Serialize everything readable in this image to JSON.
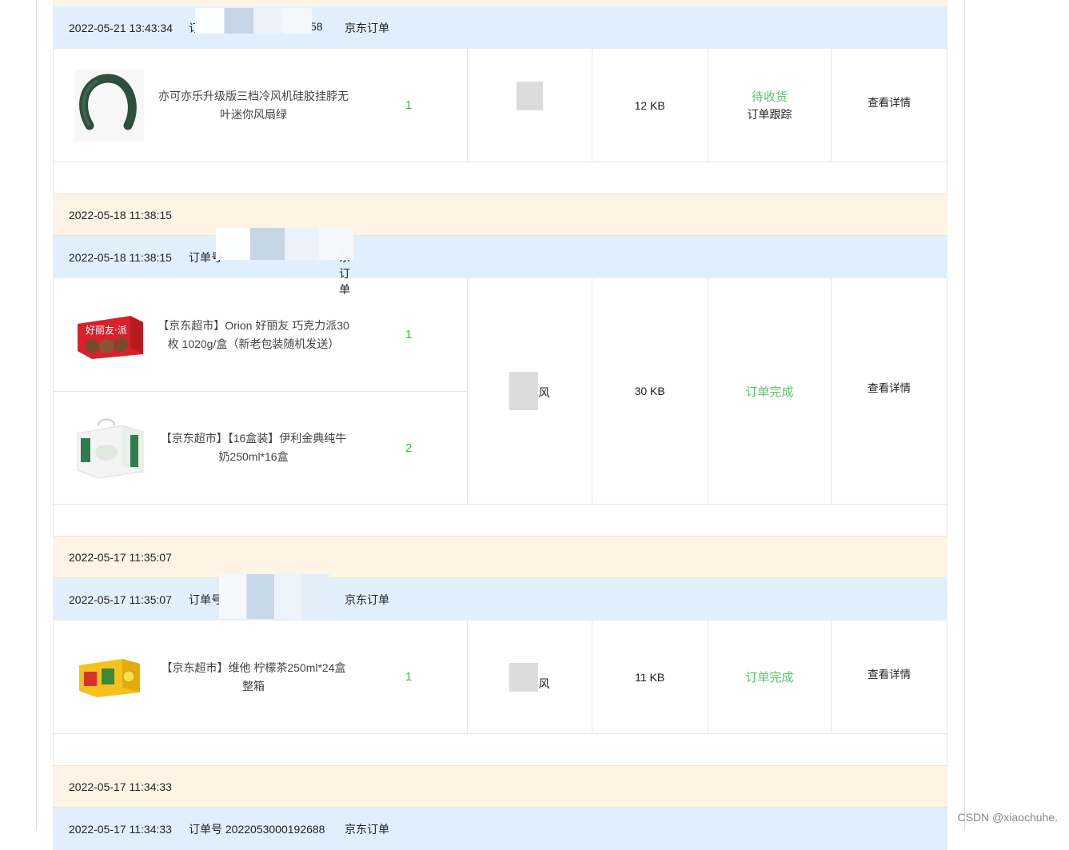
{
  "orders": [
    {
      "date_header": "",
      "time": "2022-05-21 13:43:34",
      "order_label": "订",
      "order_suffix": "58",
      "source": "京东订单",
      "items": [
        {
          "name": "亦可亦乐升级版三档冷风机硅胶挂脖无叶迷你风扇绿",
          "qty": "1",
          "img": "fan"
        }
      ],
      "pay_text": "",
      "size": "12  KB",
      "status": "待收货",
      "track": "订单跟踪",
      "action": "查看详情"
    },
    {
      "date_header": "2022-05-18 11:38:15",
      "time": "2022-05-18 11:38:15",
      "order_label": "订单号",
      "order_suffix": "东订单",
      "source": "",
      "items": [
        {
          "name": "【京东超市】Orion 好丽友 巧克力派30枚 1020g/盒（新老包装随机发送）",
          "qty": "1",
          "img": "orion"
        },
        {
          "name": "【京东超市】【16盒装】伊利金典纯牛奶250ml*16盒",
          "qty": "2",
          "img": "milk"
        }
      ],
      "pay_text": "风",
      "size": "30  KB",
      "status": "订单完成",
      "track": "",
      "action": "查看详情"
    },
    {
      "date_header": "2022-05-17 11:35:07",
      "time": "2022-05-17 11:35:07",
      "order_label": "订单号",
      "order_suffix": "",
      "source": "京东订单",
      "items": [
        {
          "name": "【京东超市】维他 柠檬茶250ml*24盒 整箱",
          "qty": "1",
          "img": "tea"
        }
      ],
      "pay_text": "风",
      "size": "11  KB",
      "status": "订单完成",
      "track": "",
      "action": "查看详情"
    },
    {
      "date_header": "2022-05-17 11:34:33",
      "time": "2022-05-17 11:34:33",
      "order_label": "订单号 2022053000192688",
      "order_suffix": "",
      "source": "京东订单",
      "items": [],
      "pay_text": "",
      "size": "",
      "status": "",
      "track": "",
      "action": ""
    }
  ],
  "watermark": "CSDN @xiaochuhe.",
  "colors": {
    "date_bar": "#fef4e6",
    "info_bar": "#e1effd",
    "status_green": "#5cc36b",
    "qty_green": "#4caf50"
  }
}
